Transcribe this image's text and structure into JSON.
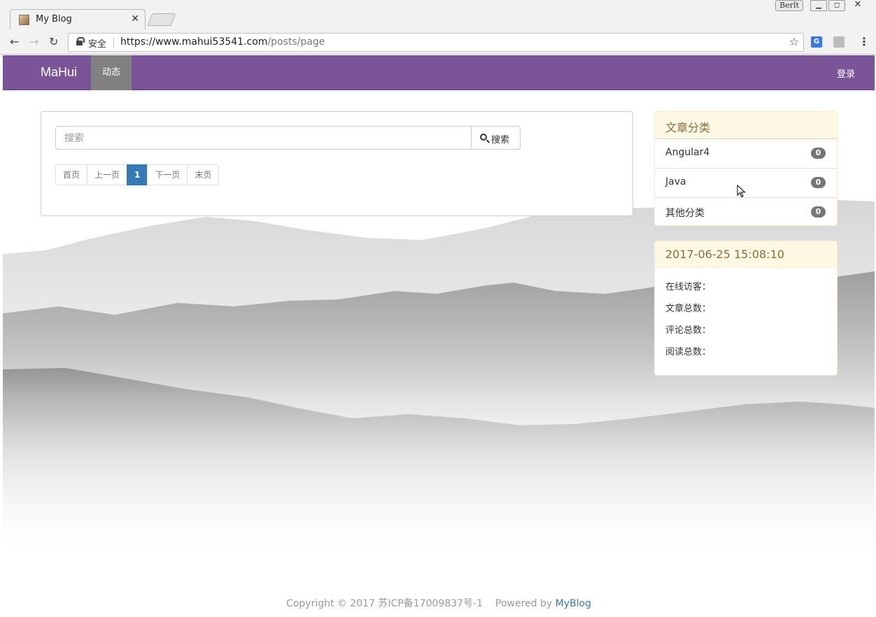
{
  "browser": {
    "tab_title": "My Blog",
    "tab_close": "✕",
    "user_badge": "Berlt",
    "secure_label": "安全",
    "url_host": "https://www.mahui53541.com",
    "url_path": "/posts/page",
    "translate_icon": "G"
  },
  "navbar": {
    "brand": "MaHui",
    "nav_active": "动态",
    "login": "登录"
  },
  "search": {
    "placeholder": "搜索",
    "button_label": "搜索"
  },
  "pagination": {
    "first": "首页",
    "prev": "上一页",
    "current": "1",
    "next": "下一页",
    "last": "末页"
  },
  "categories": {
    "title": "文章分类",
    "items": [
      {
        "label": "Angular4",
        "count": "0"
      },
      {
        "label": "Java",
        "count": "0"
      },
      {
        "label": "其他分类",
        "count": "0"
      }
    ]
  },
  "stats": {
    "datetime": "2017-06-25 15:08:10",
    "online": "在线访客：",
    "articles": "文章总数：",
    "comments": "评论总数：",
    "reads": "阅读总数："
  },
  "footer": {
    "copyright": "Copyright © 2017 苏ICP备17009837号-1",
    "powered": "Powered by",
    "link": "MyBlog"
  }
}
